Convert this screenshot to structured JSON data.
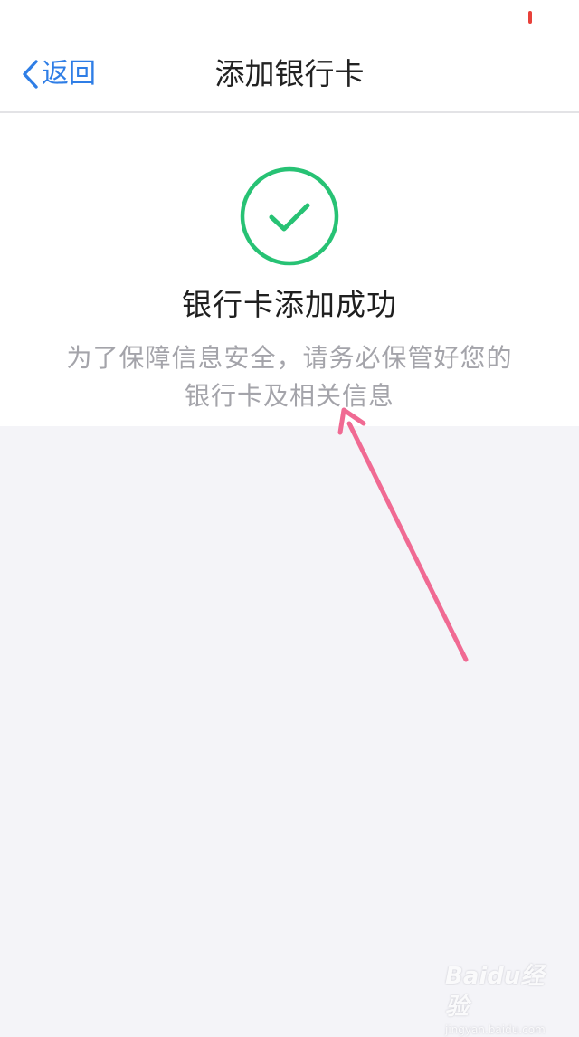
{
  "colors": {
    "accent_blue": "#2f7ee6",
    "success_green": "#27c274",
    "annotation_pink": "#f06a93",
    "status_red": "#e8413a",
    "page_background": "#f4f4f8"
  },
  "status_bar": {
    "battery_icon": "battery-low-icon"
  },
  "nav": {
    "back_icon": "chevron-left-icon",
    "back_label": "返回",
    "title": "添加银行卡"
  },
  "result": {
    "icon": "check-circle-icon",
    "title": "银行卡添加成功",
    "description": "为了保障信息安全，请务必保管好您的银行卡及相关信息"
  },
  "annotation": {
    "arrow_icon": "arrow-up-left-icon"
  },
  "watermark": {
    "logo": "Baidu经验",
    "url": "jingyan.baidu.com"
  }
}
